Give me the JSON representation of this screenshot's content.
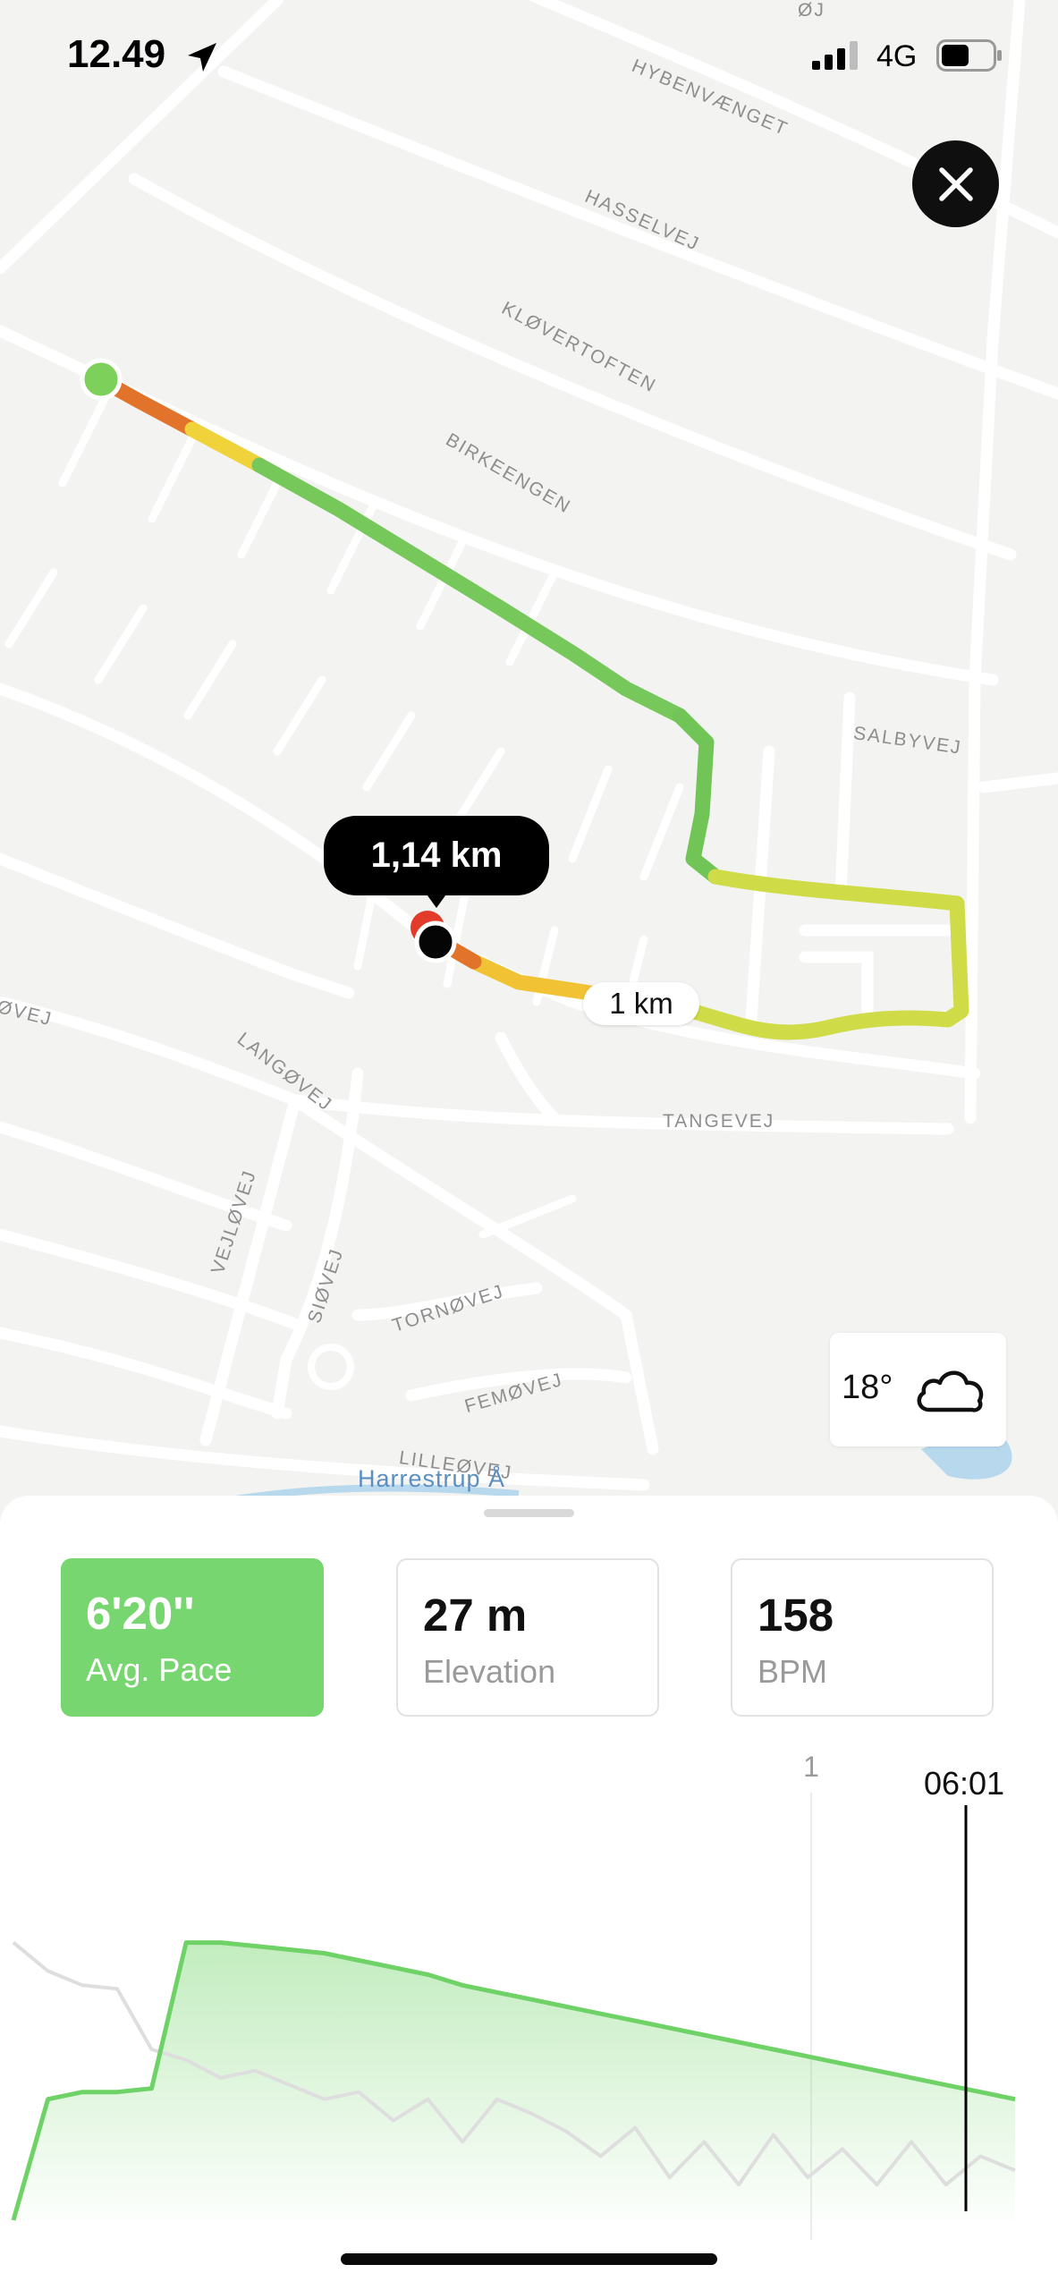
{
  "status_bar": {
    "time": "12.49",
    "network": "4G",
    "icons": [
      "location-arrow-icon",
      "signal-bars-icon",
      "battery-icon"
    ]
  },
  "map": {
    "streets": [
      "HYBENVÆNGET",
      "HASSELVEJ",
      "KLØVERTOFTEN",
      "BIRKEENGEN",
      "SALBYVEJ",
      "TANGEVEJ",
      "LANGØVEJ",
      "VEJLØVEJ",
      "SIØVEJ",
      "TORNØVEJ",
      "FEMØVEJ",
      "LILLEØVEJ",
      "ØVEJ",
      "ØJ"
    ],
    "water_label": "Harrestrup Å",
    "current_distance": "1,14 km",
    "km_marker": "1 km",
    "route_colors": {
      "start": "#e23b2a",
      "mid": "#f0d23a",
      "end": "#6cc653"
    }
  },
  "close_button": {
    "icon": "close-icon"
  },
  "weather": {
    "temperature": "18°",
    "icon": "cloud-icon"
  },
  "stats": [
    {
      "value": "6'20''",
      "label": "Avg. Pace",
      "active": true
    },
    {
      "value": "27 m",
      "label": "Elevation",
      "active": false
    },
    {
      "value": "158",
      "label": "BPM",
      "active": false
    }
  ],
  "chart_data": {
    "type": "area",
    "km_marker_label": "1",
    "cursor_label": "06:01",
    "series": [
      {
        "values": [
          0.0,
          0.34,
          0.36,
          0.36,
          0.37,
          0.78,
          0.78,
          0.77,
          0.76,
          0.75,
          0.73,
          0.71,
          0.69,
          0.66,
          0.64,
          0.62,
          0.6,
          0.58,
          0.56,
          0.54,
          0.52,
          0.5,
          0.48,
          0.46,
          0.44,
          0.42,
          0.4,
          0.38,
          0.36,
          0.34
        ]
      },
      {
        "values": [
          0.78,
          0.7,
          0.66,
          0.65,
          0.48,
          0.45,
          0.4,
          0.42,
          0.38,
          0.34,
          0.36,
          0.28,
          0.34,
          0.22,
          0.34,
          0.3,
          0.25,
          0.18,
          0.26,
          0.12,
          0.22,
          0.1,
          0.24,
          0.12,
          0.2,
          0.1,
          0.22,
          0.1,
          0.18,
          0.14
        ]
      }
    ],
    "colors": {
      "pace": "#6fd266",
      "elevation": "#dedede"
    }
  },
  "home_indicator": true
}
